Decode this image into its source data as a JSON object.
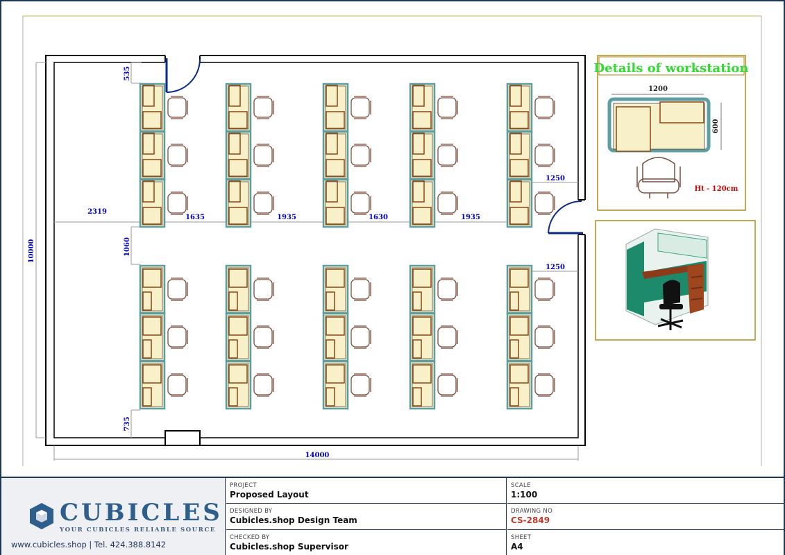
{
  "plan": {
    "dimensions": {
      "overall_width": "14000",
      "overall_height": "10000",
      "top_left_offset": "535",
      "corridor_left": "2319",
      "corridor_height": "1060",
      "bottom_left_offset": "735",
      "gaps": [
        "1635",
        "1935",
        "1630",
        "1935"
      ],
      "door_right_top": "1250",
      "door_right_bottom": "1250"
    }
  },
  "details": {
    "title": "Details of workstation",
    "width_label": "1200",
    "depth_label": "600",
    "height_note": "Ht - 120cm"
  },
  "title_block": {
    "logo_word": "CUBICLES",
    "logo_tagline": "YOUR CUBICLES RELIABLE SOURCE",
    "contact": "www.cubicles.shop  |  Tel. 424.388.8142",
    "project_label": "PROJECT",
    "project_value": "Proposed Layout",
    "designed_label": "DESIGNED BY",
    "designed_value": "Cubicles.shop Design Team",
    "checked_label": "CHECKED BY",
    "checked_value": "Cubicles.shop Supervisor",
    "scale_label": "SCALE",
    "scale_value": "1:100",
    "drawing_label": "DRAWING NO",
    "drawing_value": "CS-2849",
    "sheet_label": "SHEET",
    "sheet_value": "A4"
  },
  "colors": {
    "wall": "#000000",
    "dimension_text": "#0000cc",
    "desk_fill": "#f7f0c8",
    "desk_edge": "#8b4513",
    "partition": "#5f9ea0",
    "chair": "#7b4a3a",
    "door_arc": "#0a2a8a",
    "details_title": "#2fdc2f",
    "details_note": "#cc0000",
    "panel_border": "#b08b1e"
  }
}
